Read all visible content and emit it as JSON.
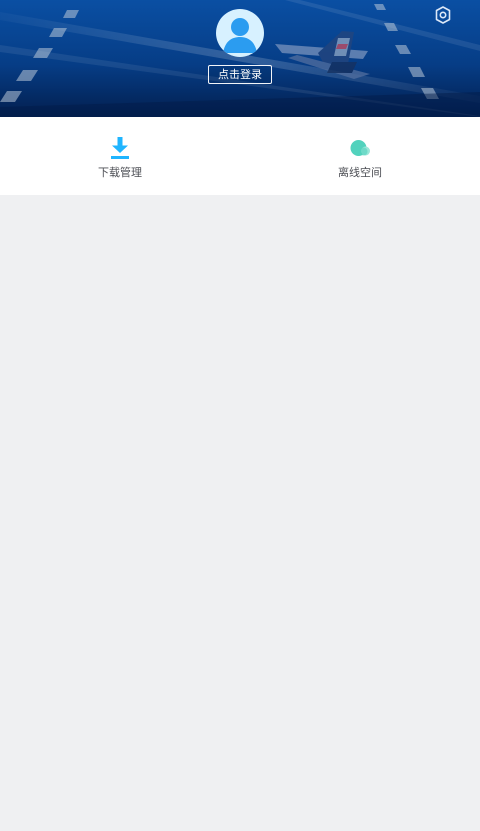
{
  "header": {
    "login_button": "点击登录",
    "settings_icon": "settings-icon",
    "avatar_icon": "user-avatar-icon"
  },
  "quick_actions": [
    {
      "label": "下载管理",
      "icon": "download-icon",
      "color": "#1fb5ff"
    },
    {
      "label": "离线空间",
      "icon": "offline-space-icon",
      "color": "#52d2bd"
    }
  ],
  "colors": {
    "header_top": "#0a4fa3",
    "header_bottom": "#031f4f",
    "avatar_bg": "#d7f1ff",
    "avatar_fg": "#2b9cf0",
    "page_bg": "#eff0f2",
    "card_bg": "#ffffff"
  }
}
